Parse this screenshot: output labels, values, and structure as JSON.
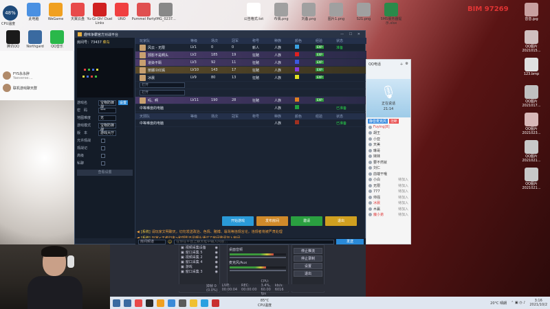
{
  "desktop": {
    "cpu_widget_value": "48%",
    "cpu_widget_label": "CPU温度",
    "left_icons": [
      {
        "label": "此电脑",
        "color": "#4a90e2"
      },
      {
        "label": "WeGame",
        "color": "#f0a020"
      },
      {
        "label": "天翼云盘",
        "color": "#e84a4a"
      },
      {
        "label": "Yu-Gi-Oh! Duel Links",
        "color": "#d02020"
      },
      {
        "label": "UNO",
        "color": "#f04040"
      },
      {
        "label": "Pummel Party",
        "color": "#e05050"
      },
      {
        "label": "IMG_0237...",
        "color": "#888888"
      }
    ],
    "left_icons_row2": [
      {
        "label": "腾讯QQ",
        "color": "#1a1a1a"
      },
      {
        "label": "Northgard",
        "color": "#3a6aa0"
      },
      {
        "label": "QQ音乐",
        "color": "#2ab84a"
      }
    ],
    "middle_icons": [
      {
        "label": "公告格式.txt",
        "color": "#ffffff"
      },
      {
        "label": "布偶.png",
        "color": "#a0a0a0"
      },
      {
        "label": "刘备.png",
        "color": "#a0a0a0"
      },
      {
        "label": "图片1.png",
        "color": "#a0a0a0"
      },
      {
        "label": "S21.png",
        "color": "#a0a0a0"
      },
      {
        "label": "5M5服务器提示.xlsx",
        "color": "#2a8a4a"
      }
    ],
    "right_icons": [
      {
        "label": "音音.jpg",
        "color": "#c8a0a0"
      },
      {
        "label": "QQ图片2021015...",
        "color": "#d0c0c0"
      },
      {
        "label": "123.bmp",
        "color": "#e0e0e0"
      },
      {
        "label": "QQ图片2021017...",
        "color": "#c0c0c0"
      },
      {
        "label": "QQ图片2021023...",
        "color": "#d8b8b8"
      },
      {
        "label": "QQ图片2021021...",
        "color": "#c8c8c8"
      },
      {
        "label": "QQ图片2021021...",
        "color": "#c8c8c8"
      }
    ],
    "overlay_text": "BIM 97269"
  },
  "chat_panel": {
    "items": [
      {
        "name": "FYS永永胖",
        "preview": "Yaeverse:..."
      },
      {
        "name": "联机游戏聊天群",
        "preview": ""
      }
    ]
  },
  "game_window": {
    "title": "趣味争霸官方对战平台",
    "room_label": "房间号：73437",
    "room_name": "菜鸟",
    "props": [
      {
        "label": "游戏名",
        "value": "宝物防御战",
        "btn": "设置"
      },
      {
        "label": "密　码",
        "value": "***"
      },
      {
        "label": "地图难度",
        "value": "无"
      },
      {
        "label": "游戏模式",
        "value": "宝物防御战"
      },
      {
        "label": "版　本",
        "value": "游戏大厅"
      }
    ],
    "checks": [
      {
        "label": "允许观战"
      },
      {
        "label": "观战记"
      },
      {
        "label": "高级"
      },
      {
        "label": "私聊"
      }
    ],
    "settings_button": "查看设置",
    "headers": [
      "玩家队",
      "等级",
      "场次",
      "冠军",
      "称号",
      "种族",
      "颜色",
      "经验",
      "状态"
    ],
    "players": [
      {
        "name": "风云 - 无限",
        "level": "LV1",
        "games": "0",
        "champ": "0",
        "title": "新人",
        "race": "人族",
        "color": "#3aa0e0",
        "exp": "EXP",
        "state": "准备",
        "type": "normal"
      },
      {
        "name": "郭影不是啊头",
        "level": "LV2",
        "games": "185",
        "champ": "19",
        "title": "狂赌",
        "race": "人族",
        "color": "#e02020",
        "exp": "EXP",
        "state": "",
        "type": "purple"
      },
      {
        "name": "道染不羁",
        "level": "LV3",
        "games": "92",
        "champ": "11",
        "title": "狂赌",
        "race": "人族",
        "color": "#3a5ae0",
        "exp": "EXP",
        "state": "",
        "type": "purple"
      },
      {
        "name": "丽娜冷红嫣",
        "level": "LV10",
        "games": "143",
        "champ": "17",
        "title": "狂赌",
        "race": "人族",
        "color": "#8a3ae0",
        "exp": "EXP",
        "state": "",
        "type": "highlight"
      },
      {
        "name": "冰晨",
        "level": "LV9",
        "games": "80",
        "champ": "13",
        "title": "狂赌",
        "race": "人族",
        "color": "#e0e020",
        "exp": "EXP",
        "state": "",
        "type": "normal"
      },
      {
        "name": "打开",
        "level": "",
        "games": "",
        "champ": "",
        "title": "",
        "race": "",
        "color": "",
        "exp": "",
        "state": "",
        "type": "dd"
      },
      {
        "name": "打开",
        "level": "",
        "games": "",
        "champ": "",
        "title": "",
        "race": "",
        "color": "",
        "exp": "",
        "state": "",
        "type": "dd"
      },
      {
        "name": "吗、啊",
        "level": "LV11",
        "games": "190",
        "champ": "28",
        "title": "狂赌",
        "race": "人族",
        "color": "#e08020",
        "exp": "EXP",
        "state": "",
        "type": "purple"
      },
      {
        "name": "中等难度的电脑",
        "level": "",
        "games": "",
        "champ": "",
        "title": "",
        "race": "人族",
        "color": "#20a040",
        "exp": "",
        "state": "已准备",
        "type": "normal"
      }
    ],
    "headers2": [
      "天邪队",
      "等级",
      "场次",
      "冠军",
      "称号",
      "种族",
      "颜色",
      "经验",
      "状态"
    ],
    "players2": [
      {
        "name": "中等难度的电脑",
        "level": "",
        "games": "",
        "champ": "",
        "title": "",
        "race": "人族",
        "color": "#a03020",
        "exp": "",
        "state": "已准备",
        "type": "normal"
      }
    ],
    "actions": [
      {
        "label": "开始游戏",
        "color": "#2a9ad8"
      },
      {
        "label": "发布房间",
        "color": "#d08a2a"
      },
      {
        "label": "邀请",
        "color": "#2aa040"
      },
      {
        "label": "退出",
        "color": "#d0a020"
      }
    ],
    "log": [
      {
        "sys": "[系统]",
        "text": "请玩家文明聊天，切勿发送政治、色情、赌博、辱骂等违规言论，违规者将被严肃处理"
      },
      {
        "sys": "[系统]",
        "text": "玩家<王者归来>和郭影不是啊头通过了房间邀请加入房间。"
      },
      {
        "sys": "[系统]",
        "text": "玩家<王者归来>在位于在线通道并且加入房间。"
      }
    ],
    "chat_channel": "房间频道",
    "chat_placeholder": "在你在平台上聊天框中输入内容...",
    "send_label": "发送"
  },
  "voice_panel": {
    "title": "QQ电话",
    "mic_label": "正在说话",
    "mic_time": "21:14",
    "btn1": "静音麦克风",
    "btn2": "挂断",
    "members": [
      {
        "name": "Fuying[8]",
        "state": "",
        "red": true
      },
      {
        "name": "胡王",
        "state": "",
        "red": false
      },
      {
        "name": "小亚",
        "state": "",
        "red": false
      },
      {
        "name": "天美",
        "state": "",
        "red": false
      },
      {
        "name": "琳哥",
        "state": "",
        "red": false
      },
      {
        "name": "妹妹",
        "state": "",
        "red": false
      },
      {
        "name": "要不然就",
        "state": "",
        "red": false
      },
      {
        "name": "刘仁",
        "state": "",
        "red": false
      },
      {
        "name": "前端干哦",
        "state": "",
        "red": false
      },
      {
        "name": "小白",
        "state": "待加入",
        "red": false
      },
      {
        "name": "无限",
        "state": "待加入",
        "red": false
      },
      {
        "name": "777",
        "state": "待加入",
        "red": false
      },
      {
        "name": "帅强",
        "state": "待加入",
        "red": false
      },
      {
        "name": "冰晨",
        "state": "待加入",
        "red": true
      },
      {
        "name": "木赢",
        "state": "待加入",
        "red": false
      },
      {
        "name": "魔小弟",
        "state": "待加入",
        "red": true
      }
    ]
  },
  "obs": {
    "sources": [
      "视频采集设备",
      "窗口采集 5",
      "视频采集 2",
      "窗口采集 4",
      "游戏",
      "窗口采集 3"
    ],
    "audio": [
      {
        "name": "桌面音频",
        "level": 0.78
      },
      {
        "name": "麦克风/Aux",
        "level": 0.65
      }
    ],
    "controls": [
      "停止推流",
      "停止录制",
      "设置",
      "退出"
    ],
    "status": [
      "掉帧 0 (0.0%)",
      "LIVE: 00:00:04",
      "REC: 00:00:00",
      "CPU: 3.4%, 60.00 fps",
      "kb/s: 6016"
    ]
  },
  "taskbar": {
    "temp": "85°C",
    "temp_label": "CPU温度",
    "weather": "20°C 晴朗",
    "time": "3:16",
    "date": "2021/10/2",
    "apps": [
      "#3a6aa0",
      "#e84a4a",
      "#2a2a2a",
      "#f0a020",
      "#3a8ad8",
      "#5a5a5a",
      "#f0c030",
      "#2aa0e0",
      "#c83030"
    ]
  }
}
